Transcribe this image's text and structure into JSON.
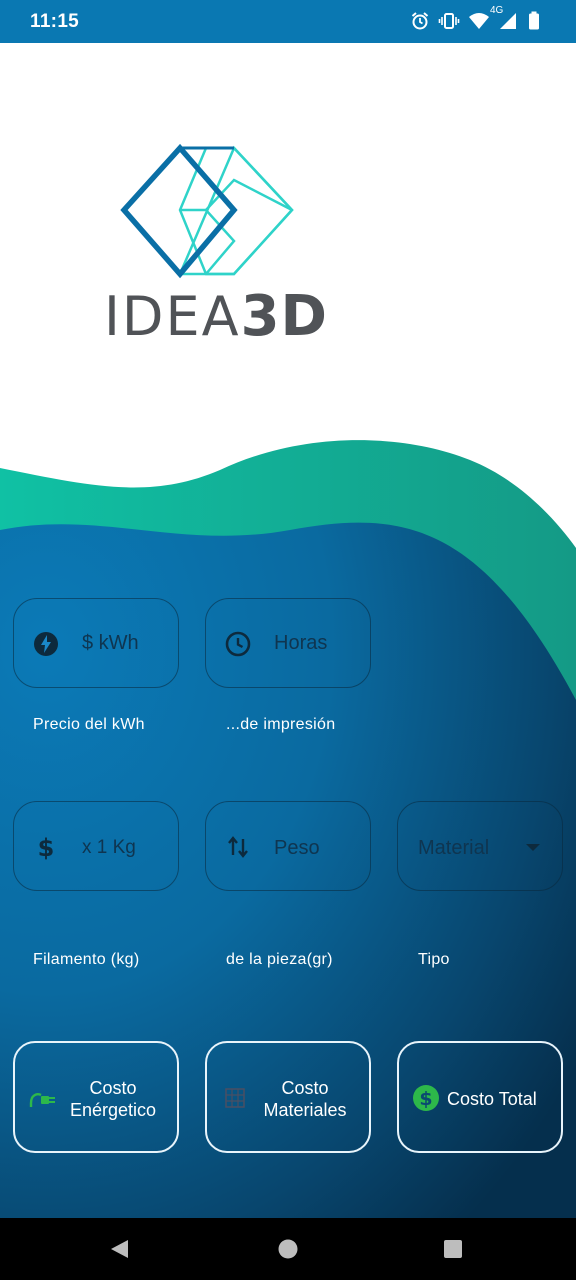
{
  "status_bar": {
    "time": "11:15",
    "network_type": "4G",
    "icons": [
      "alarm-icon",
      "vibrate-icon",
      "wifi-icon",
      "cellular-signal-icon",
      "battery-icon"
    ]
  },
  "logo": {
    "text_thin": "IDEA",
    "text_bold": "3D",
    "colors": {
      "dark_blue": "#0a6fa6",
      "teal": "#2fd3c9",
      "gray": "#555759"
    }
  },
  "inputs": {
    "kwh_price": {
      "placeholder": "$ kWh",
      "label": "Precio del kWh",
      "icon": "lightning-bolt-icon"
    },
    "print_time": {
      "placeholder": "Horas",
      "label": "...de impresión",
      "icon": "clock-icon"
    },
    "filament": {
      "placeholder": "x 1 Kg",
      "label": "Filamento (kg)",
      "icon": "dollar-icon"
    },
    "weight": {
      "placeholder": "Peso",
      "label": "de la pieza(gr)",
      "icon": "swap-vertical-icon"
    },
    "material": {
      "value": "Material",
      "label": "Tipo",
      "icon": "dropdown-arrow-icon"
    }
  },
  "buttons": {
    "energy_cost": {
      "line1": "Costo",
      "line2": "Enérgetico",
      "icon": "plug-icon"
    },
    "materials_cost": {
      "line1": "Costo",
      "line2": "Materiales",
      "icon": "grid-icon"
    },
    "total_cost": {
      "label": "Costo Total",
      "icon": "dollar-circle-icon"
    }
  },
  "theme": {
    "status_bar": "#0a78b2",
    "wave_teal": "#13b9a0",
    "wave_blue": "#0a6fa6",
    "accent_green": "#2db84a"
  }
}
